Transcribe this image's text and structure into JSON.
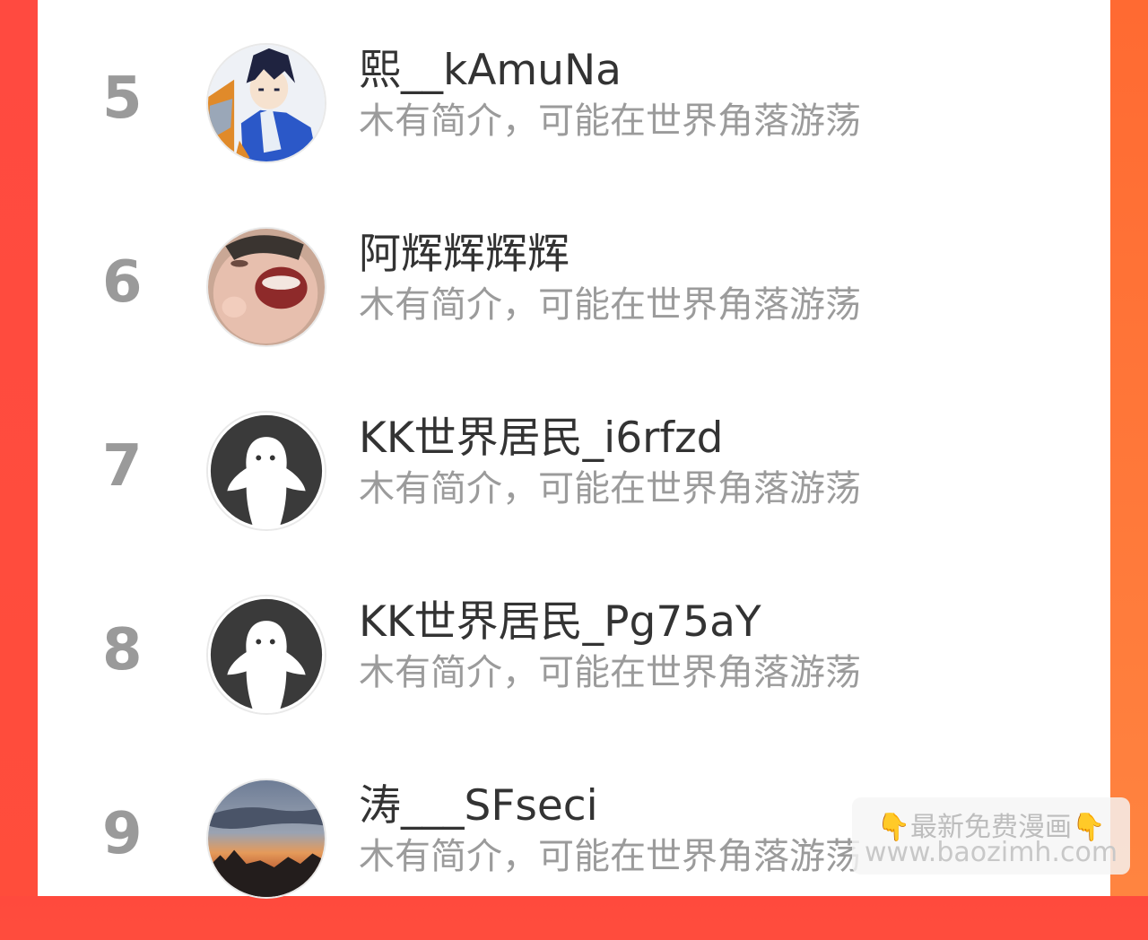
{
  "rankings": [
    {
      "rank": "5",
      "name": "熙__kAmuNa",
      "bio": "木有简介，可能在世界角落游荡",
      "avatar": "anime-character-avatar"
    },
    {
      "rank": "6",
      "name": "阿辉辉辉辉",
      "bio": "木有简介，可能在世界角落游荡",
      "avatar": "laughing-child-avatar"
    },
    {
      "rank": "7",
      "name": "KK世界居民_i6rfzd",
      "bio": "木有简介，可能在世界角落游荡",
      "avatar": "default-ghost-avatar"
    },
    {
      "rank": "8",
      "name": "KK世界居民_Pg75aY",
      "bio": "木有简介，可能在世界角落游荡",
      "avatar": "default-ghost-avatar"
    },
    {
      "rank": "9",
      "name": "涛___SFseci",
      "bio": "木有简介，可能在世界角落游荡",
      "avatar": "sunset-sky-avatar"
    }
  ],
  "watermark": {
    "title": "最新免费漫画",
    "url": "www.baozimh.com",
    "icon": "pointing-down-hand-icon"
  },
  "colors": {
    "accent_left": "#ff4a40",
    "accent_right": "#ff7a3a",
    "rank": "#9a9a9a",
    "name": "#333333",
    "bio": "#9b9b9b"
  }
}
